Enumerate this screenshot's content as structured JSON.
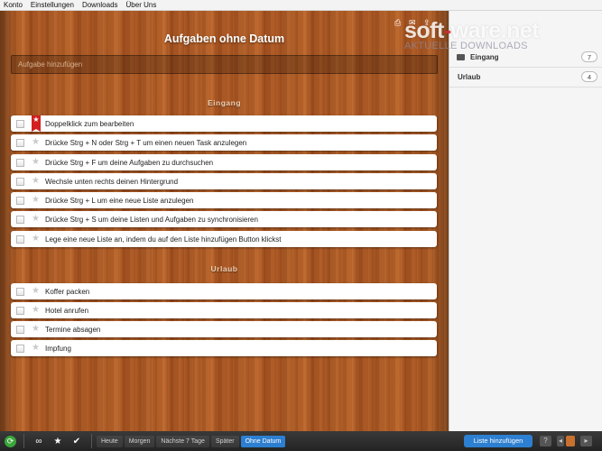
{
  "menubar": {
    "items": [
      "Konto",
      "Einstellungen",
      "Downloads",
      "Über Uns"
    ]
  },
  "main": {
    "title": "Aufgaben ohne Datum",
    "add_task_placeholder": "Aufgabe hinzufügen",
    "sections": [
      {
        "name": "Eingang",
        "tasks": [
          {
            "text": "Doppelklick zum bearbeiten",
            "starred": true
          },
          {
            "text": "Drücke Strg + N oder Strg + T um einen neuen Task anzulegen",
            "starred": false
          },
          {
            "text": "Drücke Strg + F um deine Aufgaben zu durchsuchen",
            "starred": false
          },
          {
            "text": "Wechsle unten rechts deinen Hintergrund",
            "starred": false
          },
          {
            "text": "Drücke Strg + L um eine neue Liste anzulegen",
            "starred": false
          },
          {
            "text": "Drücke Strg + S um deine Listen und Aufgaben zu synchronisieren",
            "starred": false
          },
          {
            "text": "Lege eine neue Liste an, indem du auf den Liste hinzufügen Button klickst",
            "starred": false
          }
        ]
      },
      {
        "name": "Urlaub",
        "tasks": [
          {
            "text": "Koffer packen",
            "starred": false
          },
          {
            "text": "Hotel anrufen",
            "starred": false
          },
          {
            "text": "Termine absagen",
            "starred": false
          },
          {
            "text": "Impfung",
            "starred": false
          }
        ]
      }
    ]
  },
  "sidebar": {
    "lists": [
      {
        "label": "Eingang",
        "count": "7"
      },
      {
        "label": "Urlaub",
        "count": "4"
      }
    ]
  },
  "watermark": {
    "logo_a": "soft",
    "logo_b": "ware.net",
    "sub": "AKTUELLE DOWNLOADS"
  },
  "bottombar": {
    "filters": [
      "Heute",
      "Morgen",
      "Nächste 7 Tage",
      "Später",
      "Ohne Datum"
    ],
    "active_filter": "Ohne Datum",
    "add_list_label": "Liste hinzufügen",
    "help_label": "?"
  },
  "colors": {
    "accent": "#2d7fd1",
    "flag": "#d21f1f",
    "sync": "#3aa53a"
  }
}
